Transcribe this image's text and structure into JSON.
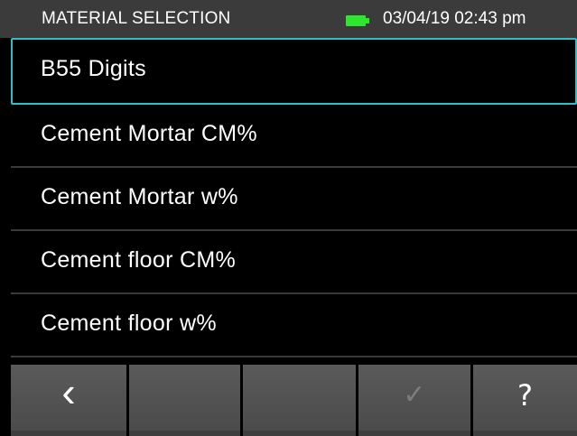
{
  "status_bar": {
    "title": "MATERIAL SELECTION",
    "battery_icon": "battery-full-icon",
    "battery_color": "#2ee62e",
    "datetime": "03/04/19 02:43 pm"
  },
  "material_list": {
    "selected_index": 0,
    "highlight_color": "#27c3c8",
    "items": [
      {
        "label": "B55 Digits"
      },
      {
        "label": "Cement Mortar CM%"
      },
      {
        "label": "Cement Mortar w%"
      },
      {
        "label": "Cement floor CM%"
      },
      {
        "label": "Cement floor w%"
      }
    ]
  },
  "toolbar": {
    "back_glyph": "‹",
    "back_icon": "chevron-left-icon",
    "confirm_glyph": "✓",
    "confirm_icon": "checkmark-icon",
    "confirm_enabled": false,
    "help_glyph": "?",
    "help_icon": "question-mark-icon"
  }
}
